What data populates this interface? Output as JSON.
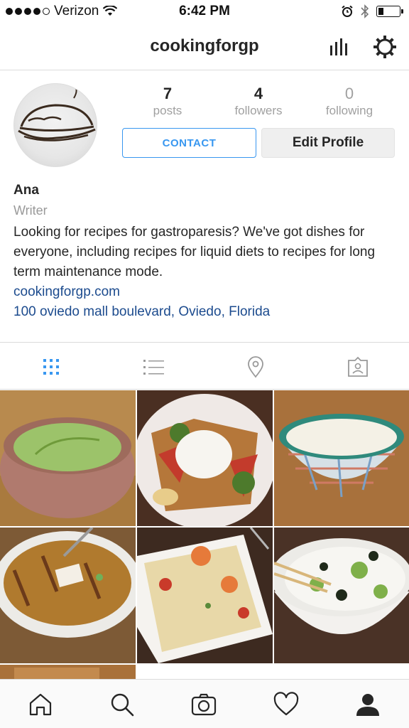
{
  "status_bar": {
    "carrier": "Verizon",
    "time": "6:42 PM",
    "battery_level": 0.25
  },
  "header": {
    "username": "cookingforgp",
    "icons": [
      "insights-icon",
      "gear-icon"
    ]
  },
  "profile": {
    "stats": [
      {
        "value": "7",
        "label": "posts"
      },
      {
        "value": "4",
        "label": "followers"
      },
      {
        "value": "0",
        "label": "following"
      }
    ],
    "contact_label": "CONTACT",
    "edit_label": "Edit Profile",
    "name": "Ana",
    "role": "Writer",
    "bio": "Looking for recipes for gastroparesis? We've got dishes for everyone, including recipes for liquid diets to recipes for long term maintenance mode.",
    "website": "cookingforgp.com",
    "address": "100 oviedo mall boulevard, Oviedo, Florida"
  },
  "view_tabs": [
    "grid-icon",
    "list-icon",
    "location-pin-icon",
    "tagged-photos-icon"
  ],
  "active_view_tab": "grid-icon",
  "posts": [
    "green-soup-photo",
    "loaded-fries-photo",
    "cream-soup-bowl-photo",
    "chicken-soup-photo",
    "orzo-shrimp-photo",
    "rice-avocado-bowl-photo",
    "partial-photo"
  ],
  "bottom_nav": [
    "home-icon",
    "search-icon",
    "camera-icon",
    "heart-icon",
    "profile-icon"
  ],
  "colors": {
    "accent": "#3897f0",
    "link": "#1c4b8e",
    "muted": "#a0a0a0"
  }
}
